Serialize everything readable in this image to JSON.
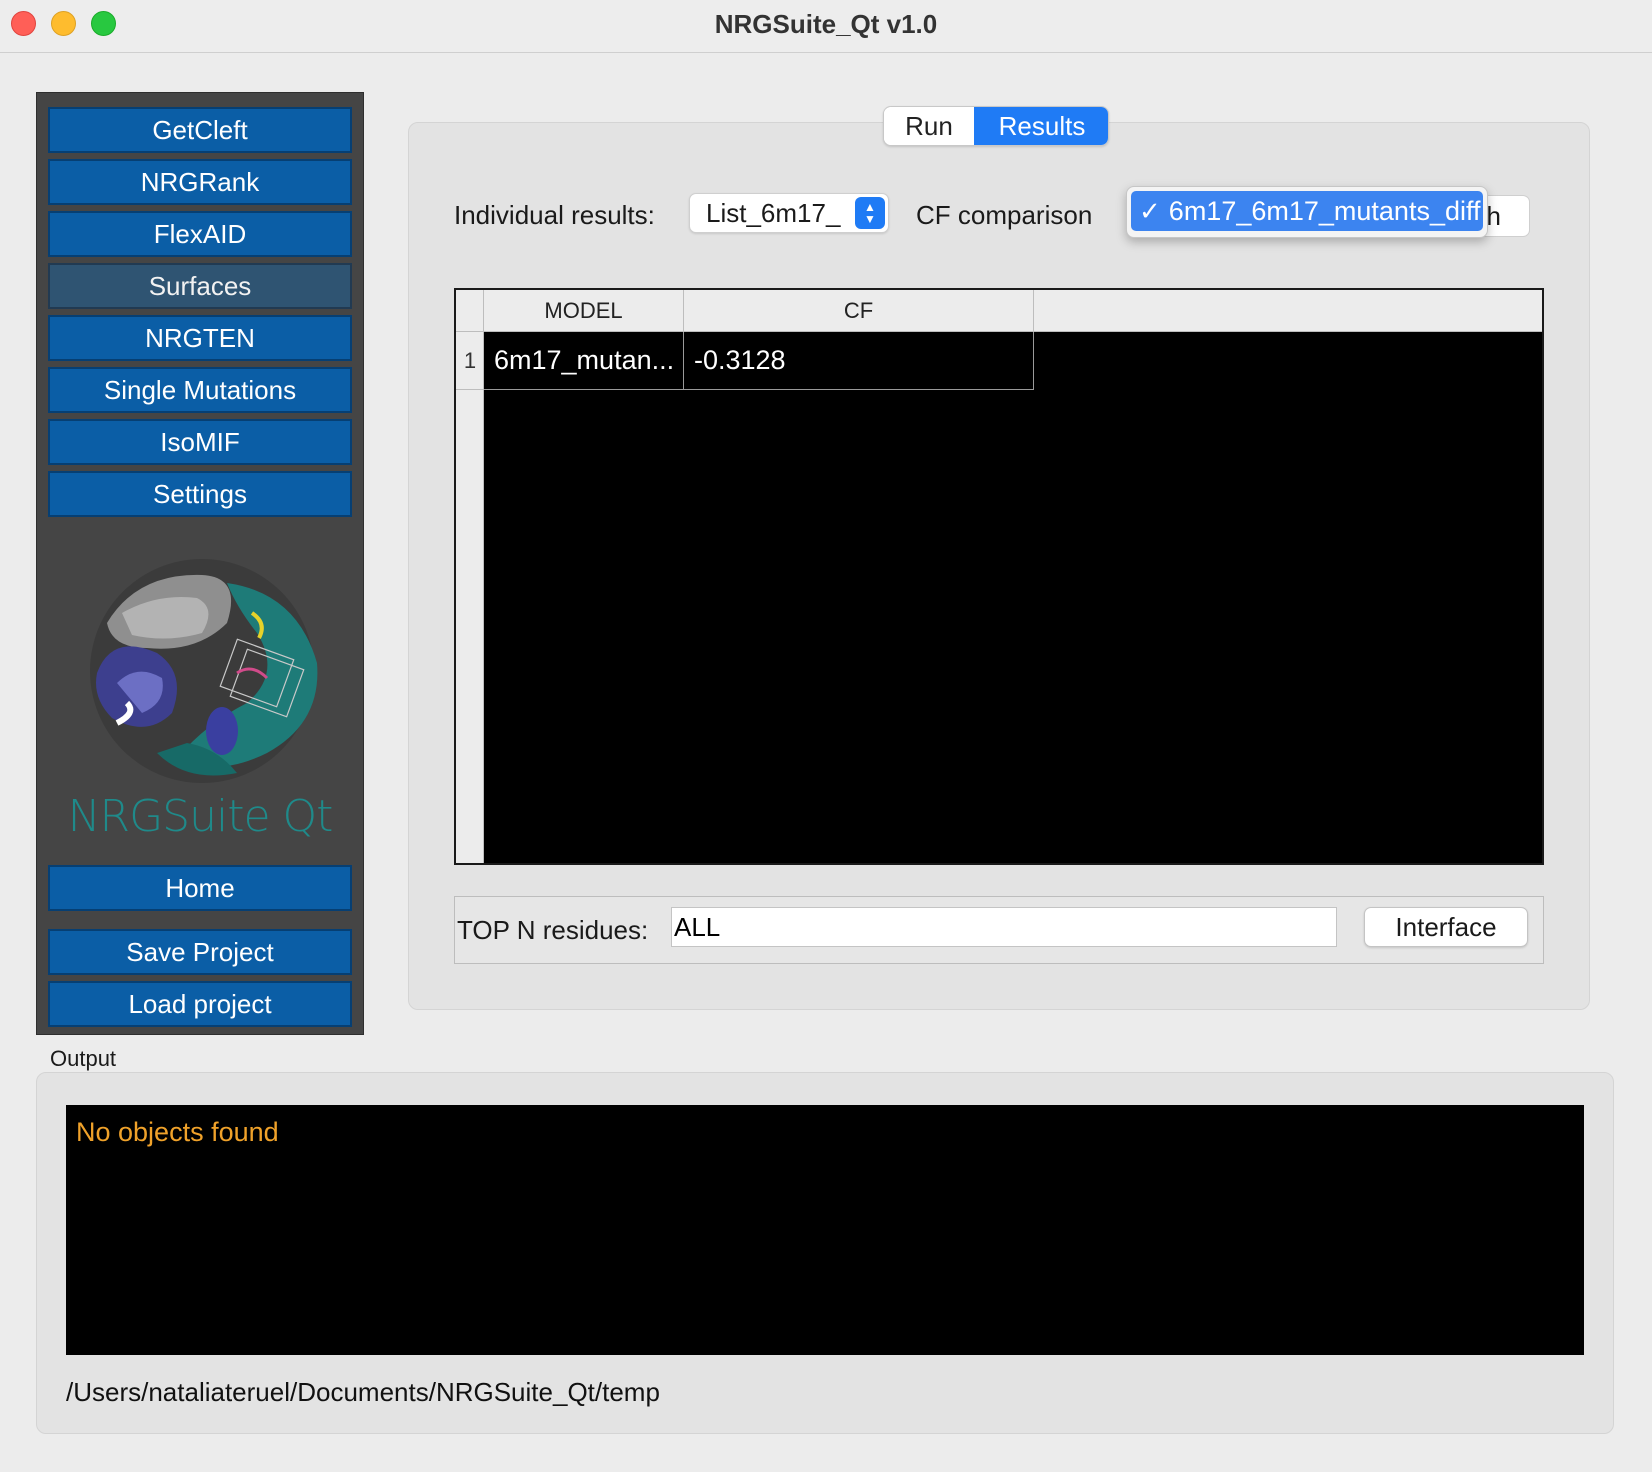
{
  "window": {
    "title": "NRGSuite_Qt v1.0"
  },
  "sidebar": {
    "items": [
      {
        "label": "GetCleft",
        "active": false
      },
      {
        "label": "NRGRank",
        "active": false
      },
      {
        "label": "FlexAID",
        "active": false
      },
      {
        "label": "Surfaces",
        "active": true
      },
      {
        "label": "NRGTEN",
        "active": false
      },
      {
        "label": "Single Mutations",
        "active": false
      },
      {
        "label": "IsoMIF",
        "active": false
      },
      {
        "label": "Settings",
        "active": false
      }
    ],
    "logo_text": "NRGSuite Qt",
    "home_label": "Home",
    "save_label": "Save Project",
    "load_label": "Load project"
  },
  "tabs": {
    "run": "Run",
    "results": "Results",
    "selected": "Results"
  },
  "results": {
    "individual_label": "Individual results:",
    "individual_value": "List_6m17_",
    "cf_label": "CF comparison",
    "cf_field_tail": "h",
    "cf_dropdown_selected": "6m17_6m17_mutants_diff"
  },
  "table": {
    "columns": [
      "MODEL",
      "CF"
    ],
    "rows": [
      {
        "index": "1",
        "model": "6m17_mutan...",
        "cf": "-0.3128"
      }
    ]
  },
  "topn": {
    "label": "TOP N residues:",
    "value": "ALL",
    "button_label": "Interface"
  },
  "output": {
    "label": "Output",
    "message": "No objects found",
    "path": "/Users/nataliateruel/Documents/NRGSuite_Qt/temp"
  },
  "colors": {
    "sidebar_button": "#0b5ea6",
    "accent": "#1f7bf5",
    "console_text": "#f0a22a",
    "logo_text": "#1f8a8a"
  }
}
